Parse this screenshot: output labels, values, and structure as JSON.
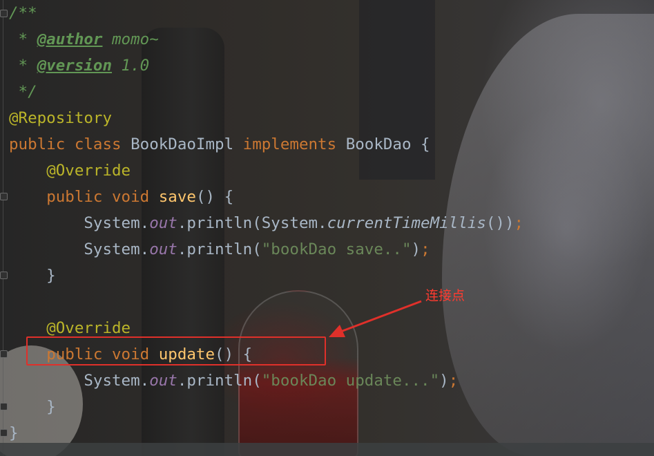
{
  "editor": {
    "lines": [
      [
        {
          "t": "/**",
          "c": "c-doc"
        }
      ],
      [
        {
          "t": " * ",
          "c": "c-doc"
        },
        {
          "t": "@author",
          "c": "c-tag"
        },
        {
          "t": " momo~",
          "c": "c-doc"
        }
      ],
      [
        {
          "t": " * ",
          "c": "c-doc"
        },
        {
          "t": "@version",
          "c": "c-tag"
        },
        {
          "t": " 1.0",
          "c": "c-doc"
        }
      ],
      [
        {
          "t": " */",
          "c": "c-doc"
        }
      ],
      [
        {
          "t": "@Repository",
          "c": "c-ann"
        }
      ],
      [
        {
          "t": "public class ",
          "c": "c-kw"
        },
        {
          "t": "BookDaoImpl ",
          "c": "c-pl"
        },
        {
          "t": "implements ",
          "c": "c-kw"
        },
        {
          "t": "BookDao {",
          "c": "c-pl"
        }
      ],
      [
        {
          "t": "    ",
          "c": "c-pl"
        },
        {
          "t": "@Override",
          "c": "c-ann"
        }
      ],
      [
        {
          "t": "    ",
          "c": "c-pl"
        },
        {
          "t": "public void ",
          "c": "c-kw"
        },
        {
          "t": "save",
          "c": "c-fn"
        },
        {
          "t": "() {",
          "c": "c-pl"
        }
      ],
      [
        {
          "t": "        System.",
          "c": "c-pl"
        },
        {
          "t": "out",
          "c": "c-fld"
        },
        {
          "t": ".println(System.",
          "c": "c-pl"
        },
        {
          "t": "currentTimeMillis",
          "c": "c-it"
        },
        {
          "t": "())",
          "c": "c-pl"
        },
        {
          "t": ";",
          "c": "c-kw"
        }
      ],
      [
        {
          "t": "        System.",
          "c": "c-pl"
        },
        {
          "t": "out",
          "c": "c-fld"
        },
        {
          "t": ".println(",
          "c": "c-pl"
        },
        {
          "t": "\"bookDao save..\"",
          "c": "c-str"
        },
        {
          "t": ")",
          "c": "c-pl"
        },
        {
          "t": ";",
          "c": "c-kw"
        }
      ],
      [
        {
          "t": "    }",
          "c": "c-pl"
        }
      ],
      [
        {
          "t": "",
          "c": "c-pl"
        }
      ],
      [
        {
          "t": "    ",
          "c": "c-pl"
        },
        {
          "t": "@Override",
          "c": "c-ann"
        }
      ],
      [
        {
          "t": "    ",
          "c": "c-pl"
        },
        {
          "t": "public void ",
          "c": "c-kw"
        },
        {
          "t": "update",
          "c": "c-fn"
        },
        {
          "t": "() {",
          "c": "c-pl"
        }
      ],
      [
        {
          "t": "        System.",
          "c": "c-pl"
        },
        {
          "t": "out",
          "c": "c-fld"
        },
        {
          "t": ".println(",
          "c": "c-pl"
        },
        {
          "t": "\"bookDao update...\"",
          "c": "c-str"
        },
        {
          "t": ")",
          "c": "c-pl"
        },
        {
          "t": ";",
          "c": "c-kw"
        }
      ],
      [
        {
          "t": "    }",
          "c": "c-pl"
        }
      ],
      [
        {
          "t": "}",
          "c": "c-pl"
        }
      ]
    ]
  },
  "annotation": {
    "label": "连接点",
    "color": "#e0302a"
  },
  "colors": {
    "keyword": "#cc7832",
    "annotation": "#bbb529",
    "method": "#ffc66d",
    "field": "#9876aa",
    "string": "#6a8759",
    "doc": "#629755",
    "plain": "#a9b7c6"
  }
}
